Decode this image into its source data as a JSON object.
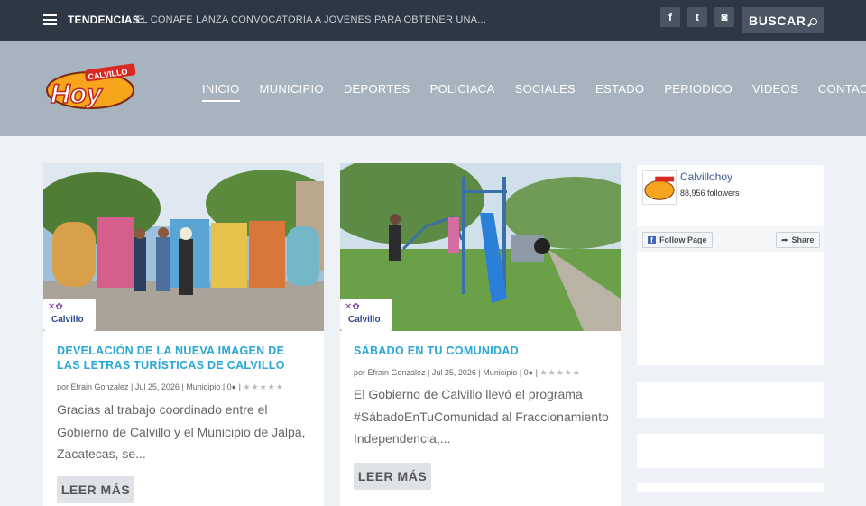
{
  "topbar": {
    "trend_label": "TENDENCIAS:",
    "trend_text": "EL CONAFE LANZA CONVOCATORIA A JOVENES PARA OBTENER UNA...",
    "social": [
      {
        "icon": "facebook-icon",
        "glyph": "f"
      },
      {
        "icon": "twitter-icon",
        "glyph": "t"
      },
      {
        "icon": "instagram-icon",
        "glyph": "◙"
      }
    ],
    "search_label": "BUSCAR"
  },
  "logo": {
    "text_top": "CALVILLO",
    "text_main": "Hoy"
  },
  "nav": {
    "items": [
      {
        "label": "INICIO",
        "active": true
      },
      {
        "label": "MUNICIPIO",
        "active": false
      },
      {
        "label": "DEPORTES",
        "active": false
      },
      {
        "label": "POLICIACA",
        "active": false
      },
      {
        "label": "SOCIALES",
        "active": false
      },
      {
        "label": "ESTADO",
        "active": false
      },
      {
        "label": "PERIODICO",
        "active": false
      },
      {
        "label": "VIDEOS",
        "active": false
      },
      {
        "label": "CONTACTO",
        "active": false
      }
    ]
  },
  "posts": [
    {
      "title": "DEVELACIÓN DE LA NUEVA IMAGEN DE LAS LETRAS TURÍSTICAS DE CALVILLO",
      "author": "por Efrain Gonzalez",
      "date": "Jul 25, 2026",
      "category": "Municipio",
      "comments": "0",
      "rating": "★★★★★",
      "excerpt": "Gracias al trabajo coordinado entre el Gobierno de Calvillo y el Municipio de Jalpa, Zacatecas, se...",
      "button": "LEER MÁS",
      "badge": "Calvillo"
    },
    {
      "title": "SÁBADO EN TU COMUNIDAD",
      "author": "por Efrain Gonzalez",
      "date": "Jul 25, 2026",
      "category": "Municipio",
      "comments": "0",
      "rating": "★★★★★",
      "excerpt": "El Gobierno de Calvillo llevó el programa #SábadoEnTuComunidad al Fraccionamiento Independencia,...",
      "button": "LEER MÁS",
      "badge": "Calvillo"
    }
  ],
  "facebook": {
    "page_name": "Calvillohoy",
    "followers": "88,956 followers",
    "follow_label": "Follow Page",
    "share_label": "Share"
  },
  "colors": {
    "accent": "#2aa7d6",
    "topbar": "#2e3845",
    "header": "#a8b3c0"
  }
}
